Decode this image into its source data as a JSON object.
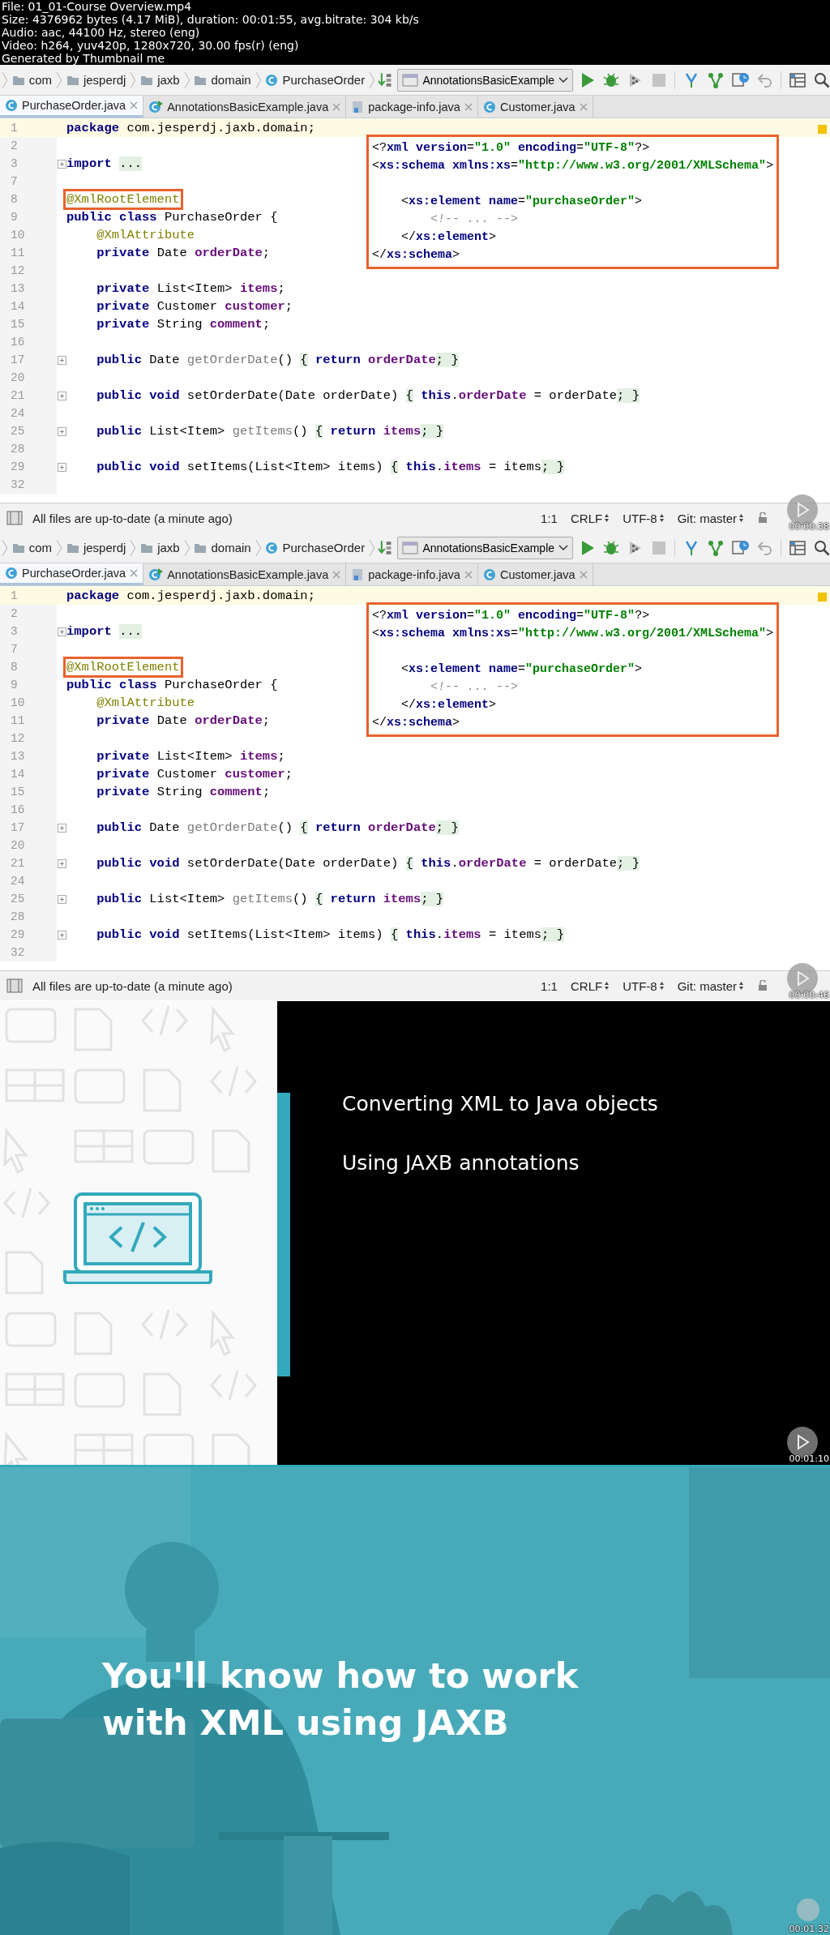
{
  "info_header": {
    "lines": [
      "File: 01_01-Course Overview.mp4",
      "Size: 4376962 bytes (4.17 MiB), duration: 00:01:55, avg.bitrate: 304 kb/s",
      "Audio: aac, 44100 Hz, stereo (eng)",
      "Video: h264, yuv420p, 1280x720, 30.00 fps(r) (eng)",
      "Generated by Thumbnail me"
    ]
  },
  "frames": [
    {
      "kind": "ide",
      "timestamp": "00:00:38",
      "breadcrumbs": [
        {
          "label": "com",
          "kind": "package"
        },
        {
          "label": "jesperdj",
          "kind": "package"
        },
        {
          "label": "jaxb",
          "kind": "package"
        },
        {
          "label": "domain",
          "kind": "package"
        },
        {
          "label": "PurchaseOrder",
          "kind": "class"
        }
      ],
      "run_config": "AnnotationsBasicExample",
      "tabs": [
        {
          "label": "PurchaseOrder.java",
          "kind": "class",
          "selected": true
        },
        {
          "label": "AnnotationsBasicExample.java",
          "kind": "runnable-class",
          "selected": false
        },
        {
          "label": "package-info.java",
          "kind": "package-info",
          "selected": false
        },
        {
          "label": "Customer.java",
          "kind": "class",
          "selected": false
        }
      ],
      "code_lines": [
        {
          "number": "1",
          "current": true,
          "fold": false,
          "tokens": [
            {
              "kind": "kw",
              "text": "package"
            },
            {
              "kind": "pl",
              "text": " com.jesperdj.jaxb.domain;"
            }
          ]
        },
        {
          "number": "2",
          "current": false,
          "fold": false
        },
        {
          "number": "3",
          "current": false,
          "fold": true,
          "tokens": [
            {
              "kind": "kw",
              "text": "import "
            },
            {
              "kind": "fd",
              "text": "..."
            }
          ]
        },
        {
          "number": "7",
          "current": false,
          "fold": false
        },
        {
          "number": "8",
          "current": false,
          "fold": false,
          "tokens": [
            {
              "kind": "box",
              "text": "@XmlRootElement"
            }
          ]
        },
        {
          "number": "9",
          "current": false,
          "fold": false,
          "tokens": [
            {
              "kind": "kw",
              "text": "public class"
            },
            {
              "kind": "pl",
              "text": " PurchaseOrder {"
            }
          ]
        },
        {
          "number": "10",
          "current": false,
          "fold": false,
          "tokens": [
            {
              "kind": "an",
              "text": "    @XmlAttribute"
            }
          ]
        },
        {
          "number": "11",
          "current": false,
          "fold": false,
          "tokens": [
            {
              "kind": "kw",
              "text": "    private"
            },
            {
              "kind": "pl",
              "text": " Date "
            },
            {
              "kind": "fl",
              "text": "orderDate"
            },
            {
              "kind": "pl",
              "text": ";"
            }
          ]
        },
        {
          "number": "12",
          "current": false,
          "fold": false
        },
        {
          "number": "13",
          "current": false,
          "fold": false,
          "tokens": [
            {
              "kind": "kw",
              "text": "    private"
            },
            {
              "kind": "pl",
              "text": " List<Item> "
            },
            {
              "kind": "fl",
              "text": "items"
            },
            {
              "kind": "pl",
              "text": ";"
            }
          ]
        },
        {
          "number": "14",
          "current": false,
          "fold": false,
          "tokens": [
            {
              "kind": "kw",
              "text": "    private"
            },
            {
              "kind": "pl",
              "text": " Customer "
            },
            {
              "kind": "fl",
              "text": "customer"
            },
            {
              "kind": "pl",
              "text": ";"
            }
          ]
        },
        {
          "number": "15",
          "current": false,
          "fold": false,
          "tokens": [
            {
              "kind": "kw",
              "text": "    private"
            },
            {
              "kind": "pl",
              "text": " String "
            },
            {
              "kind": "fl",
              "text": "comment"
            },
            {
              "kind": "pl",
              "text": ";"
            }
          ]
        },
        {
          "number": "16",
          "current": false,
          "fold": false
        },
        {
          "number": "17",
          "current": false,
          "fold": true,
          "tokens": [
            {
              "kind": "kw",
              "text": "    public"
            },
            {
              "kind": "pl",
              "text": " Date "
            },
            {
              "kind": "gr",
              "text": "getOrderDate"
            },
            {
              "kind": "pl",
              "text": "() "
            },
            {
              "kind": "fd",
              "text": "{"
            },
            {
              "kind": "kw",
              "text": " return"
            },
            {
              "kind": "fl",
              "text": " orderDate"
            },
            {
              "kind": "fd",
              "text": "; }"
            }
          ]
        },
        {
          "number": "20",
          "current": false,
          "fold": false
        },
        {
          "number": "21",
          "current": false,
          "fold": true,
          "tokens": [
            {
              "kind": "kw",
              "text": "    public void"
            },
            {
              "kind": "pl",
              "text": " setOrderDate(Date orderDate) "
            },
            {
              "kind": "fd",
              "text": "{"
            },
            {
              "kind": "kw",
              "text": " this"
            },
            {
              "kind": "pl",
              "text": "."
            },
            {
              "kind": "fl",
              "text": "orderDate"
            },
            {
              "kind": "pl",
              "text": " = orderDate"
            },
            {
              "kind": "fd",
              "text": "; }"
            }
          ]
        },
        {
          "number": "24",
          "current": false,
          "fold": false
        },
        {
          "number": "25",
          "current": false,
          "fold": true,
          "tokens": [
            {
              "kind": "kw",
              "text": "    public"
            },
            {
              "kind": "pl",
              "text": " List<Item> "
            },
            {
              "kind": "gr",
              "text": "getItems"
            },
            {
              "kind": "pl",
              "text": "() "
            },
            {
              "kind": "fd",
              "text": "{"
            },
            {
              "kind": "kw",
              "text": " return"
            },
            {
              "kind": "fl",
              "text": " items"
            },
            {
              "kind": "fd",
              "text": "; }"
            }
          ]
        },
        {
          "number": "28",
          "current": false,
          "fold": false
        },
        {
          "number": "29",
          "current": false,
          "fold": true,
          "tokens": [
            {
              "kind": "kw",
              "text": "    public void"
            },
            {
              "kind": "pl",
              "text": " setItems(List<Item> items) "
            },
            {
              "kind": "fd",
              "text": "{"
            },
            {
              "kind": "kw",
              "text": " this"
            },
            {
              "kind": "pl",
              "text": "."
            },
            {
              "kind": "fl",
              "text": "items"
            },
            {
              "kind": "pl",
              "text": " = items"
            },
            {
              "kind": "fd",
              "text": "; }"
            }
          ]
        },
        {
          "number": "32",
          "current": false,
          "fold": false
        }
      ],
      "xml_callout": {
        "lines": [
          {
            "kind": "code",
            "tokens": [
              {
                "kind": "pl",
                "text": "<?"
              },
              {
                "kind": "tg",
                "text": "xml version"
              },
              {
                "kind": "pl",
                "text": "="
              },
              {
                "kind": "st",
                "text": "\"1.0\""
              },
              {
                "kind": "tg",
                "text": " encoding"
              },
              {
                "kind": "pl",
                "text": "="
              },
              {
                "kind": "st",
                "text": "\"UTF-8\""
              },
              {
                "kind": "pl",
                "text": "?>"
              }
            ]
          },
          {
            "kind": "code",
            "tokens": [
              {
                "kind": "pl",
                "text": "<"
              },
              {
                "kind": "tg",
                "text": "xs:schema xmlns:xs"
              },
              {
                "kind": "pl",
                "text": "="
              },
              {
                "kind": "st",
                "text": "\"http://www.w3.org/2001/XMLSchema\""
              },
              {
                "kind": "pl",
                "text": ">"
              }
            ]
          },
          {
            "kind": "blank"
          },
          {
            "kind": "code",
            "tokens": [
              {
                "kind": "pl",
                "text": "    <"
              },
              {
                "kind": "tg",
                "text": "xs:element name"
              },
              {
                "kind": "pl",
                "text": "="
              },
              {
                "kind": "st",
                "text": "\"purchaseOrder\""
              },
              {
                "kind": "pl",
                "text": ">"
              }
            ]
          },
          {
            "kind": "code",
            "tokens": [
              {
                "kind": "cm",
                "text": "        <!-- ... -->"
              }
            ]
          },
          {
            "kind": "code",
            "tokens": [
              {
                "kind": "pl",
                "text": "    </"
              },
              {
                "kind": "tg",
                "text": "xs:element"
              },
              {
                "kind": "pl",
                "text": ">"
              }
            ]
          },
          {
            "kind": "code",
            "tokens": [
              {
                "kind": "pl",
                "text": "</"
              },
              {
                "kind": "tg",
                "text": "xs:schema"
              },
              {
                "kind": "pl",
                "text": ">"
              }
            ]
          }
        ]
      },
      "status_bar": {
        "message": "All files are up-to-date (a minute ago)",
        "position": "1:1",
        "line_separator": "CRLF",
        "encoding": "UTF-8",
        "vcs": "Git: master"
      }
    },
    {
      "kind": "ide",
      "timestamp": "00:00:46",
      "breadcrumbs": [
        {
          "label": "com",
          "kind": "package"
        },
        {
          "label": "jesperdj",
          "kind": "package"
        },
        {
          "label": "jaxb",
          "kind": "package"
        },
        {
          "label": "domain",
          "kind": "package"
        },
        {
          "label": "PurchaseOrder",
          "kind": "class"
        }
      ],
      "run_config": "AnnotationsBasicExample",
      "tabs": [
        {
          "label": "PurchaseOrder.java",
          "kind": "class",
          "selected": true
        },
        {
          "label": "AnnotationsBasicExample.java",
          "kind": "runnable-class",
          "selected": false
        },
        {
          "label": "package-info.java",
          "kind": "package-info",
          "selected": false
        },
        {
          "label": "Customer.java",
          "kind": "class",
          "selected": false
        }
      ],
      "code_lines": [
        {
          "number": "1",
          "current": true,
          "fold": false,
          "tokens": [
            {
              "kind": "kw",
              "text": "package"
            },
            {
              "kind": "pl",
              "text": " com.jesperdj.jaxb.domain;"
            }
          ]
        },
        {
          "number": "2",
          "current": false,
          "fold": false
        },
        {
          "number": "3",
          "current": false,
          "fold": true,
          "tokens": [
            {
              "kind": "kw",
              "text": "import "
            },
            {
              "kind": "fd",
              "text": "..."
            }
          ]
        },
        {
          "number": "7",
          "current": false,
          "fold": false
        },
        {
          "number": "8",
          "current": false,
          "fold": false,
          "tokens": [
            {
              "kind": "box",
              "text": "@XmlRootElement"
            }
          ]
        },
        {
          "number": "9",
          "current": false,
          "fold": false,
          "tokens": [
            {
              "kind": "kw",
              "text": "public class"
            },
            {
              "kind": "pl",
              "text": " PurchaseOrder {"
            }
          ]
        },
        {
          "number": "10",
          "current": false,
          "fold": false,
          "tokens": [
            {
              "kind": "an",
              "text": "    @XmlAttribute"
            }
          ]
        },
        {
          "number": "11",
          "current": false,
          "fold": false,
          "tokens": [
            {
              "kind": "kw",
              "text": "    private"
            },
            {
              "kind": "pl",
              "text": " Date "
            },
            {
              "kind": "fl",
              "text": "orderDate"
            },
            {
              "kind": "pl",
              "text": ";"
            }
          ]
        },
        {
          "number": "12",
          "current": false,
          "fold": false
        },
        {
          "number": "13",
          "current": false,
          "fold": false,
          "tokens": [
            {
              "kind": "kw",
              "text": "    private"
            },
            {
              "kind": "pl",
              "text": " List<Item> "
            },
            {
              "kind": "fl",
              "text": "items"
            },
            {
              "kind": "pl",
              "text": ";"
            }
          ]
        },
        {
          "number": "14",
          "current": false,
          "fold": false,
          "tokens": [
            {
              "kind": "kw",
              "text": "    private"
            },
            {
              "kind": "pl",
              "text": " Customer "
            },
            {
              "kind": "fl",
              "text": "customer"
            },
            {
              "kind": "pl",
              "text": ";"
            }
          ]
        },
        {
          "number": "15",
          "current": false,
          "fold": false,
          "tokens": [
            {
              "kind": "kw",
              "text": "    private"
            },
            {
              "kind": "pl",
              "text": " String "
            },
            {
              "kind": "fl",
              "text": "comment"
            },
            {
              "kind": "pl",
              "text": ";"
            }
          ]
        },
        {
          "number": "16",
          "current": false,
          "fold": false
        },
        {
          "number": "17",
          "current": false,
          "fold": true,
          "tokens": [
            {
              "kind": "kw",
              "text": "    public"
            },
            {
              "kind": "pl",
              "text": " Date "
            },
            {
              "kind": "gr",
              "text": "getOrderDate"
            },
            {
              "kind": "pl",
              "text": "() "
            },
            {
              "kind": "fd",
              "text": "{"
            },
            {
              "kind": "kw",
              "text": " return"
            },
            {
              "kind": "fl",
              "text": " orderDate"
            },
            {
              "kind": "fd",
              "text": "; }"
            }
          ]
        },
        {
          "number": "20",
          "current": false,
          "fold": false
        },
        {
          "number": "21",
          "current": false,
          "fold": true,
          "tokens": [
            {
              "kind": "kw",
              "text": "    public void"
            },
            {
              "kind": "pl",
              "text": " setOrderDate(Date orderDate) "
            },
            {
              "kind": "fd",
              "text": "{"
            },
            {
              "kind": "kw",
              "text": " this"
            },
            {
              "kind": "pl",
              "text": "."
            },
            {
              "kind": "fl",
              "text": "orderDate"
            },
            {
              "kind": "pl",
              "text": " = orderDate"
            },
            {
              "kind": "fd",
              "text": "; }"
            }
          ]
        },
        {
          "number": "24",
          "current": false,
          "fold": false
        },
        {
          "number": "25",
          "current": false,
          "fold": true,
          "tokens": [
            {
              "kind": "kw",
              "text": "    public"
            },
            {
              "kind": "pl",
              "text": " List<Item> "
            },
            {
              "kind": "gr",
              "text": "getItems"
            },
            {
              "kind": "pl",
              "text": "() "
            },
            {
              "kind": "fd",
              "text": "{"
            },
            {
              "kind": "kw",
              "text": " return"
            },
            {
              "kind": "fl",
              "text": " items"
            },
            {
              "kind": "fd",
              "text": "; }"
            }
          ]
        },
        {
          "number": "28",
          "current": false,
          "fold": false
        },
        {
          "number": "29",
          "current": false,
          "fold": true,
          "tokens": [
            {
              "kind": "kw",
              "text": "    public void"
            },
            {
              "kind": "pl",
              "text": " setItems(List<Item> items) "
            },
            {
              "kind": "fd",
              "text": "{"
            },
            {
              "kind": "kw",
              "text": " this"
            },
            {
              "kind": "pl",
              "text": "."
            },
            {
              "kind": "fl",
              "text": "items"
            },
            {
              "kind": "pl",
              "text": " = items"
            },
            {
              "kind": "fd",
              "text": "; }"
            }
          ]
        },
        {
          "number": "32",
          "current": false,
          "fold": false
        }
      ],
      "xml_callout": {
        "lines": [
          {
            "kind": "code",
            "tokens": [
              {
                "kind": "pl",
                "text": "<?"
              },
              {
                "kind": "tg",
                "text": "xml version"
              },
              {
                "kind": "pl",
                "text": "="
              },
              {
                "kind": "st",
                "text": "\"1.0\""
              },
              {
                "kind": "tg",
                "text": " encoding"
              },
              {
                "kind": "pl",
                "text": "="
              },
              {
                "kind": "st",
                "text": "\"UTF-8\""
              },
              {
                "kind": "pl",
                "text": "?>"
              }
            ]
          },
          {
            "kind": "code",
            "tokens": [
              {
                "kind": "pl",
                "text": "<"
              },
              {
                "kind": "tg",
                "text": "xs:schema xmlns:xs"
              },
              {
                "kind": "pl",
                "text": "="
              },
              {
                "kind": "st",
                "text": "\"http://www.w3.org/2001/XMLSchema\""
              },
              {
                "kind": "pl",
                "text": ">"
              }
            ]
          },
          {
            "kind": "blank"
          },
          {
            "kind": "code",
            "tokens": [
              {
                "kind": "pl",
                "text": "    <"
              },
              {
                "kind": "tg",
                "text": "xs:element name"
              },
              {
                "kind": "pl",
                "text": "="
              },
              {
                "kind": "st",
                "text": "\"purchaseOrder\""
              },
              {
                "kind": "pl",
                "text": ">"
              }
            ]
          },
          {
            "kind": "code",
            "tokens": [
              {
                "kind": "cm",
                "text": "        <!-- ... -->"
              }
            ]
          },
          {
            "kind": "code",
            "tokens": [
              {
                "kind": "pl",
                "text": "    </"
              },
              {
                "kind": "tg",
                "text": "xs:element"
              },
              {
                "kind": "pl",
                "text": ">"
              }
            ]
          },
          {
            "kind": "code",
            "tokens": [
              {
                "kind": "pl",
                "text": "</"
              },
              {
                "kind": "tg",
                "text": "xs:schema"
              },
              {
                "kind": "pl",
                "text": ">"
              }
            ]
          }
        ]
      },
      "status_bar": {
        "message": "All files are up-to-date (a minute ago)",
        "position": "1:1",
        "line_separator": "CRLF",
        "encoding": "UTF-8",
        "vcs": "Git: master"
      }
    },
    {
      "kind": "slide",
      "timestamp": "00:01:10",
      "bullets": [
        "Converting XML to Java objects",
        "Using JAXB annotations"
      ]
    },
    {
      "kind": "title",
      "timestamp": "00:01:32",
      "heading_lines": [
        "You'll know how to work",
        "with XML using JAXB"
      ],
      "background": {
        "kind": "picture"
      }
    }
  ]
}
